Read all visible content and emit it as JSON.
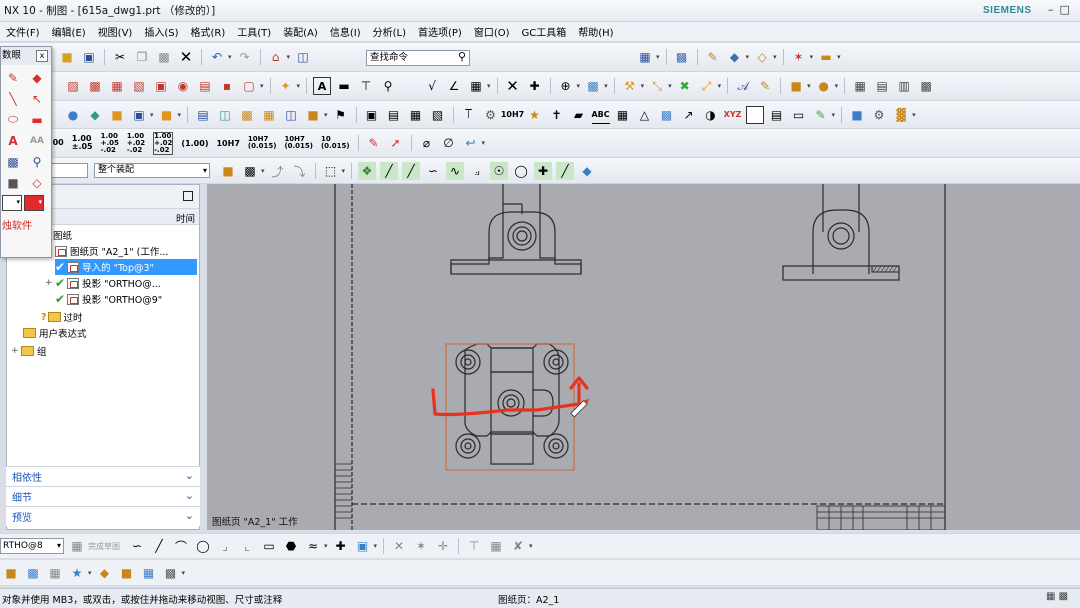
{
  "window": {
    "title": "NX 10 - 制图 - [615a_dwg1.prt （修改的）]",
    "brand": "SIEMENS",
    "controls": [
      "–",
      "□"
    ]
  },
  "menu": [
    "文件(F)",
    "编辑(E)",
    "视图(V)",
    "插入(S)",
    "格式(R)",
    "工具(T)",
    "装配(A)",
    "信息(I)",
    "分析(L)",
    "首选项(P)",
    "窗口(O)",
    "GC工具箱",
    "帮助(H)"
  ],
  "command_search": {
    "placeholder": "查找命令"
  },
  "filter": {
    "value": "整个装配"
  },
  "dim_buttons": [
    "1.00",
    "1.00\n±.05",
    "1.00\n+.05\n-.02",
    "1.00\n+.02\n-.02",
    "1.00\n+.02\n-.02",
    "(1.00)",
    "10H7",
    "10H7\n(0.015)",
    "10H7\n(0.015)",
    "10\n(0.015)"
  ],
  "toolbar_labels": {
    "abc": "ABC",
    "xyz": "XYZ",
    "h7": "10H7"
  },
  "palette": {
    "title": "数眼",
    "close": "x",
    "brand": "烛软件"
  },
  "navigator": {
    "column_header": "时间",
    "tree": [
      {
        "label": "图纸",
        "indent": 0,
        "type": "text"
      },
      {
        "label": "图纸页 \"A2_1\" (工作...",
        "indent": 1,
        "type": "sheet"
      },
      {
        "label": "导入的 \"Top@3\"",
        "indent": 2,
        "type": "view",
        "selected": true
      },
      {
        "label": "投影 \"ORTHO@...",
        "indent": 2,
        "type": "view",
        "expander": "+"
      },
      {
        "label": "投影 \"ORTHO@9\"",
        "indent": 2,
        "type": "view"
      },
      {
        "label": "过时",
        "indent": 1,
        "type": "outdated"
      },
      {
        "label": "用户表达式",
        "indent": 0,
        "type": "folder"
      },
      {
        "label": "组",
        "indent": 0,
        "type": "folder",
        "expander": "+"
      }
    ],
    "panels": [
      "相依性",
      "细节",
      "预览"
    ]
  },
  "canvas": {
    "sheet_label": "图纸页 \"A2_1\" 工作",
    "colors": {
      "background": "#a9abb1",
      "ink": "#2a2a2a",
      "annotation": "#e8321e",
      "selection": "#e06a2a"
    }
  },
  "bottom": {
    "view_select": "RTHO@8",
    "view_label": "完成草图"
  },
  "status": {
    "message": "对象并使用 MB3，或双击，或按住并拖动来移动视图、尺寸或注释",
    "sheet": "图纸页：A2_1"
  }
}
